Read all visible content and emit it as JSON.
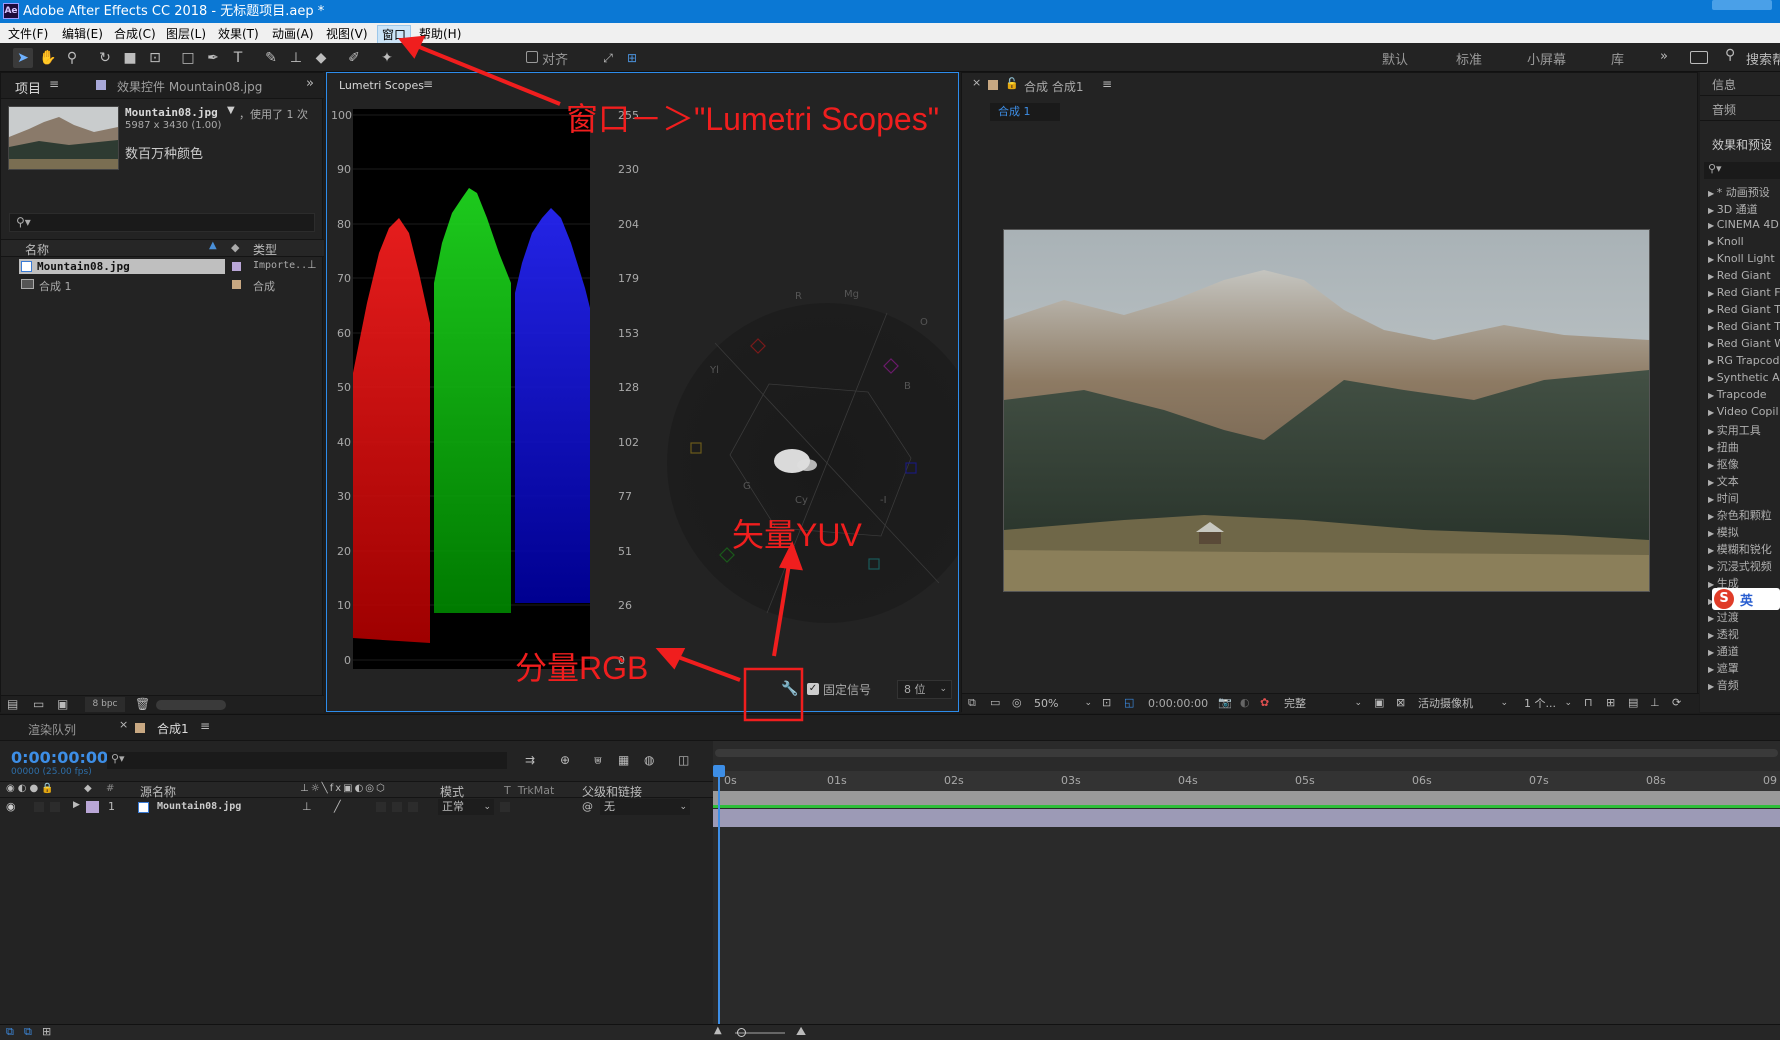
{
  "window": {
    "title": "Adobe After Effects CC 2018 - 无标题项目.aep *",
    "app_icon": "Ae"
  },
  "menu": [
    "文件(F)",
    "编辑(E)",
    "合成(C)",
    "图层(L)",
    "效果(T)",
    "动画(A)",
    "视图(V)",
    "窗口",
    "帮助(H)"
  ],
  "toolbar": {
    "align_label": "对齐",
    "workspaces": [
      "默认",
      "标准",
      "小屏幕",
      "库"
    ],
    "search_placeholder": "搜索帮"
  },
  "project": {
    "tab_label": "项目",
    "effect_tab_label": "效果控件 Mountain08.jpg",
    "file_name": "Mountain08.jpg",
    "usage": "，使用了 1 次",
    "file_info": "5987 x 3430 (1.00)",
    "color_info": "数百万种颜色",
    "col_name": "名称",
    "col_type": "类型",
    "items": [
      {
        "name": "Mountain08.jpg",
        "type": "Importe..",
        "color": "#b9a6d6"
      },
      {
        "name": "合成 1",
        "type": "合成",
        "color": "#c8a882"
      }
    ],
    "bpc": "8 bpc"
  },
  "scopes": {
    "tab_label": "Lumetri Scopes",
    "left_ticks": [
      "100",
      "90",
      "80",
      "70",
      "60",
      "50",
      "40",
      "30",
      "20",
      "10",
      "0"
    ],
    "right_ticks": [
      "255",
      "230",
      "204",
      "179",
      "153",
      "128",
      "102",
      "77",
      "51",
      "26",
      "0"
    ],
    "vector_labels": [
      "R",
      "Mg",
      "B",
      "Cy",
      "G",
      "Yl",
      "O",
      "-I"
    ],
    "clamp_label": "固定信号",
    "bit_depth": "8 位"
  },
  "comp": {
    "tab_label": "合成 合成1",
    "sub_tab": "合成 1",
    "zoom": "50%",
    "timecode": "0:00:00:00",
    "resolution": "完整",
    "camera": "活动摄像机",
    "views": "1 个..."
  },
  "right_panel": {
    "tabs": [
      "信息",
      "音频",
      "效果和预设"
    ],
    "effects": [
      "* 动画预设",
      "3D 通道",
      "CINEMA 4D",
      "Knoll",
      "Knoll Light",
      "Red Giant",
      "Red Giant F",
      "Red Giant T",
      "Red Giant T",
      "Red Giant W",
      "RG Trapcode",
      "Synthetic A",
      "Trapcode",
      "Video Copil",
      "实用工具",
      "扭曲",
      "抠像",
      "文本",
      "时间",
      "杂色和颗粒",
      "模拟",
      "模糊和锐化",
      "沉浸式视频",
      "生成",
      "过时",
      "过渡",
      "透视",
      "通道",
      "遮罩",
      "音频"
    ],
    "ime_label": "英"
  },
  "timeline": {
    "render_queue_tab": "渲染队列",
    "comp_tab": "合成1",
    "timecode": "0:00:00:00",
    "frame_info": "00000 (25.00 fps)",
    "col_source": "源名称",
    "col_mode": "模式",
    "col_trkmat": "T  TrkMat",
    "col_parent": "父级和链接",
    "ruler": [
      "0s",
      "01s",
      "02s",
      "03s",
      "04s",
      "05s",
      "06s",
      "07s",
      "08s",
      "09"
    ],
    "layer": {
      "index": "1",
      "name": "Mountain08.jpg",
      "mode": "正常",
      "parent": "无"
    }
  },
  "annotations": {
    "window_lumetri": "窗口－＞\"Lumetri Scopes\"",
    "vector_yuv": "矢量YUV",
    "parade_rgb": "分量RGB"
  },
  "colors": {
    "accent": "#2d8ceb",
    "annotation": "#f01e1e",
    "titlebar": "#0b78d4"
  }
}
